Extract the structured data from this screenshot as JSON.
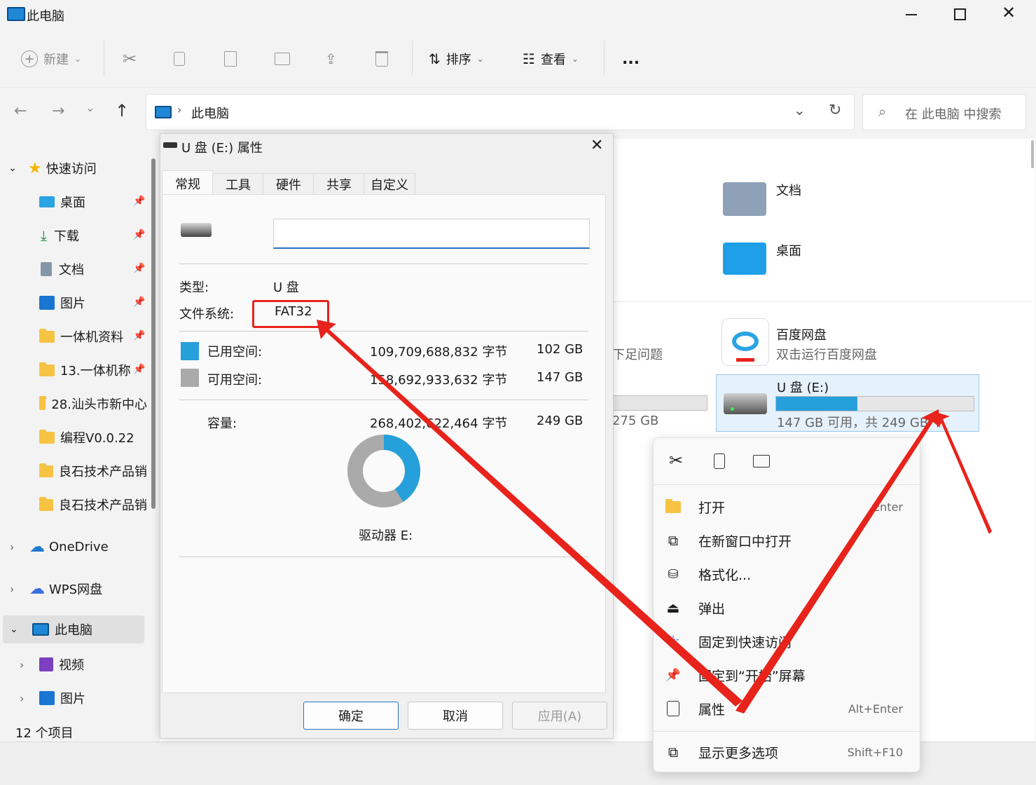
{
  "window": {
    "title": "此电脑"
  },
  "toolbar": {
    "new_label": "新建",
    "sort_label": "排序",
    "view_label": "查看",
    "more_label": "..."
  },
  "address": {
    "location": "此电脑",
    "search_placeholder": "在 此电脑 中搜索"
  },
  "nav": {
    "quick_access": "快速访问",
    "items": [
      {
        "label": "桌面"
      },
      {
        "label": "下载"
      },
      {
        "label": "文档"
      },
      {
        "label": "图片"
      },
      {
        "label": "一体机资料"
      },
      {
        "label": "13.一体机称"
      },
      {
        "label": "28.汕头市新中心"
      },
      {
        "label": "编程V0.0.22"
      },
      {
        "label": "良石技术产品销"
      },
      {
        "label": "良石技术产品销"
      }
    ],
    "onedrive": "OneDrive",
    "wps": "WPS网盘",
    "this_pc": "此电脑",
    "videos": "视频",
    "pictures": "图片"
  },
  "status": {
    "count": "12 个项目"
  },
  "content": {
    "folders": [
      {
        "label": "文档"
      },
      {
        "label": "桌面"
      }
    ],
    "partial_text": "下足问题",
    "partial_size": "275 GB",
    "baidu": {
      "name": "百度网盘",
      "desc": "双击运行百度网盘"
    },
    "usb": {
      "name": "U 盘 (E:)",
      "free_text": "147 GB 可用，共 249 GB",
      "used_fraction": 0.41
    }
  },
  "dialog": {
    "title": "U 盘 (E:) 属性",
    "tabs": [
      "常规",
      "工具",
      "硬件",
      "共享",
      "自定义"
    ],
    "name_value": "",
    "type_label": "类型:",
    "type_value": "U 盘",
    "fs_label": "文件系统:",
    "fs_value": "FAT32",
    "used_label": "已用空间:",
    "used_bytes": "109,709,688,832 字节",
    "used_size": "102 GB",
    "free_label": "可用空间:",
    "free_bytes": "158,692,933,632 字节",
    "free_size": "147 GB",
    "cap_label": "容量:",
    "cap_bytes": "268,402,622,464 字节",
    "cap_size": "249 GB",
    "drive_label": "驱动器 E:",
    "used_fraction": 0.41,
    "ok": "确定",
    "cancel": "取消",
    "apply": "应用(A)",
    "colors": {
      "used": "#26a0da",
      "free": "#aaaaaa"
    }
  },
  "context_menu": {
    "items": [
      {
        "label": "打开",
        "key": "Enter"
      },
      {
        "label": "在新窗口中打开",
        "key": ""
      },
      {
        "label": "格式化...",
        "key": ""
      },
      {
        "label": "弹出",
        "key": ""
      },
      {
        "label": "固定到快速访问",
        "key": ""
      },
      {
        "label": "固定到“开始”屏幕",
        "key": ""
      },
      {
        "label": "属性",
        "key": "Alt+Enter"
      }
    ],
    "more": {
      "label": "显示更多选项",
      "key": "Shift+F10"
    }
  }
}
